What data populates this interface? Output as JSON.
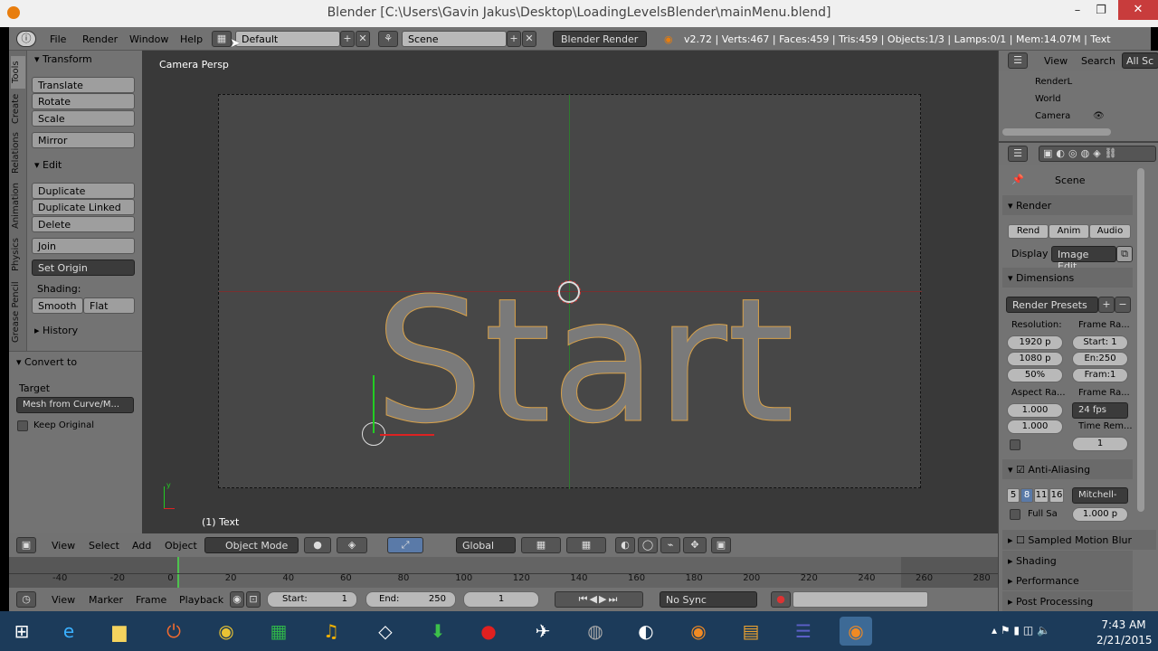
{
  "window": {
    "title": "Blender [C:\\Users\\Gavin Jakus\\Desktop\\LoadingLevelsBlender\\mainMenu.blend]",
    "minimize": "–",
    "maximize": "❐",
    "close": "✕"
  },
  "info": {
    "menus": [
      "File",
      "Render",
      "Window",
      "Help"
    ],
    "screen_layout": "Default",
    "scene": "Scene",
    "engine": "Blender Render",
    "stats": "v2.72 | Verts:467 | Faces:459 | Tris:459 | Objects:1/3 | Lamps:0/1 | Mem:14.07M | Text",
    "add": "+",
    "remove": "✕"
  },
  "tabs": [
    "Tools",
    "Create",
    "Relations",
    "Animation",
    "Physics",
    "Grease Pencil"
  ],
  "tools": {
    "transform_header": "Transform",
    "translate": "Translate",
    "rotate": "Rotate",
    "scale": "Scale",
    "mirror": "Mirror",
    "edit_header": "Edit",
    "duplicate": "Duplicate",
    "duplicate_linked": "Duplicate Linked",
    "delete": "Delete",
    "join": "Join",
    "set_origin": "Set Origin",
    "shading_label": "Shading:",
    "smooth": "Smooth",
    "flat": "Flat",
    "history_header": "History",
    "convert_header": "Convert to",
    "target_label": "Target",
    "target_value": "Mesh from Curve/M...",
    "keep_original": "Keep Original"
  },
  "viewport": {
    "view_name": "Camera Persp",
    "object_info": "(1) Text",
    "text_object": "Start",
    "axis_y": "y"
  },
  "view3d_header": {
    "menus": [
      "View",
      "Select",
      "Add",
      "Object"
    ],
    "mode": "Object Mode",
    "orientation": "Global"
  },
  "timeline": {
    "ticks": [
      "-40",
      "-20",
      "0",
      "20",
      "40",
      "60",
      "80",
      "100",
      "120",
      "140",
      "160",
      "180",
      "200",
      "220",
      "240",
      "260",
      "280"
    ]
  },
  "timeline_header": {
    "menus": [
      "View",
      "Marker",
      "Frame",
      "Playback"
    ],
    "start_label": "Start:",
    "start_value": "1",
    "end_label": "End:",
    "end_value": "250",
    "current": "1",
    "sync": "No Sync"
  },
  "outliner": {
    "menus": [
      "View",
      "Search",
      "All Sc"
    ],
    "items": [
      "RenderL",
      "World",
      "Camera"
    ]
  },
  "properties": {
    "breadcrumb": "Scene",
    "render_header": "Render",
    "rend": "Rend",
    "anim": "Anim",
    "audio": "Audio",
    "display_label": "Display",
    "display_value": "Image Edit",
    "dimensions_header": "Dimensions",
    "render_presets": "Render Presets",
    "resolution_label": "Resolution:",
    "frame_range_label": "Frame Ra...",
    "res_x": "1920 p",
    "res_y": "1080 p",
    "res_pct": "50%",
    "start": "Start: 1",
    "end": "En:250",
    "frame_step": "Fram:1",
    "aspect_label": "Aspect Ra...",
    "frame_rate_label": "Frame Ra...",
    "aspect_x": "1.000",
    "aspect_y": "1.000",
    "fps": "24 fps",
    "time_remap_label": "Time Rem...",
    "time_remap_value": "1",
    "aa_header": "Anti-Aliasing",
    "aa_samples": [
      "5",
      "8",
      "11",
      "16"
    ],
    "aa_filter": "Mitchell-",
    "full_sample": "Full Sa",
    "filter_size": "1.000 p",
    "sampled_motion": "Sampled Motion Blur",
    "shading": "Shading",
    "performance": "Performance",
    "post_processing": "Post Processing"
  },
  "taskbar": {
    "time": "7:43 AM",
    "date": "2/21/2015"
  }
}
